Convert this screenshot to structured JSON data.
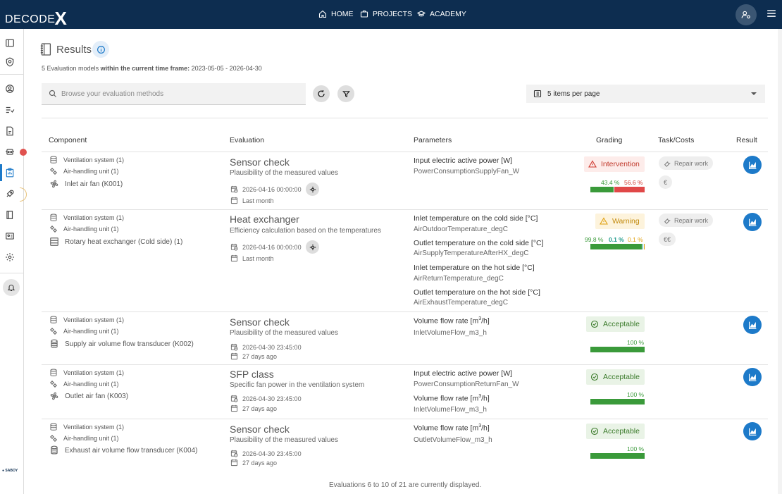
{
  "app": {
    "brand": "DECODE",
    "brand_x": "X",
    "nav": [
      {
        "label": "HOME",
        "icon": "home-icon"
      },
      {
        "label": "PROJECTS",
        "icon": "folder-icon"
      },
      {
        "label": "ACADEMY",
        "icon": "graduation-cap-icon"
      }
    ],
    "company_label": "SABOY",
    "accent_color": "#0d2d50",
    "primary_color": "#1d7ac9"
  },
  "results": {
    "title": "Results",
    "count": "5",
    "models_text": "Evaluation models",
    "timeframe_label": "within the current time frame:",
    "timeframe_value": "2023-05-05 - 2026-04-30",
    "search_placeholder": "Browse your evaluation methods",
    "per_page": "5 items per page"
  },
  "table": {
    "headers": {
      "component": "Component",
      "evaluation": "Evaluation",
      "parameters": "Parameters",
      "grading": "Grading",
      "task_costs": "Task/Costs",
      "result": "Result"
    },
    "rows": [
      {
        "system": "Ventilation system (1)",
        "unit": "Air-handling unit (1)",
        "component": "Inlet air fan (K001)",
        "component_icon": "fan-icon",
        "eval_title": "Sensor check",
        "eval_sub": "Plausibility of the measured values",
        "date": "2026-04-16 00:00:00",
        "relative": "Last month",
        "params": [
          {
            "name": "Input electric active power [W]",
            "var": "PowerConsumptionSupplyFan_W"
          }
        ],
        "grade": "Intervention",
        "grade_type": "red",
        "pcts": [
          "43.4 %",
          "56.6 %"
        ],
        "pct_values": [
          43.4,
          56.6
        ],
        "task": "Repair work",
        "cost": "€"
      },
      {
        "system": "Ventilation system (1)",
        "unit": "Air-handling unit (1)",
        "component": "Rotary heat exchanger (Cold side) (1)",
        "component_icon": "heat-exchanger-icon",
        "eval_title": "Heat exchanger",
        "eval_sub": "Efficiency calculation based on the temperatures",
        "date": "2026-04-16 00:00:00",
        "relative": "Last month",
        "params": [
          {
            "name": "Inlet temperature on the cold side [°C]",
            "var": "AirOutdoorTemperature_degC"
          },
          {
            "name": "Outlet temperature on the cold side [°C]",
            "var": "AirSupplyTemperatureAfterHX_degC"
          },
          {
            "name": "Inlet temperature on the hot side [°C]",
            "var": "AirReturnTemperature_degC"
          },
          {
            "name": "Outlet temperature on the hot side [°C]",
            "var": "AirExhaustTemperature_degC"
          }
        ],
        "grade": "Warning",
        "grade_type": "yellow",
        "pcts": [
          "99.8 %",
          "0.1 %",
          "0.1 %"
        ],
        "pct_values": [
          99.8,
          0.1,
          0.1
        ],
        "task": "Repair work",
        "cost": "€€"
      },
      {
        "system": "Ventilation system (1)",
        "unit": "Air-handling unit (1)",
        "component": "Supply air volume flow transducer (K002)",
        "component_icon": "flow-transducer-icon",
        "eval_title": "Sensor check",
        "eval_sub": "Plausibility of the measured values",
        "date": "2026-04-30 23:45:00",
        "relative": "27 days ago",
        "params": [
          {
            "name": "Volume flow rate",
            "unit_base": "[m",
            "unit_sup": "3",
            "unit_end": "/h]",
            "var": "InletVolumeFlow_m3_h"
          }
        ],
        "grade": "Acceptable",
        "grade_type": "green",
        "pcts": [
          "100 %"
        ],
        "pct_values": [
          100
        ],
        "task": "",
        "cost": ""
      },
      {
        "system": "Ventilation system (1)",
        "unit": "Air-handling unit (1)",
        "component": "Outlet air fan (K003)",
        "component_icon": "fan-icon",
        "eval_title": "SFP class",
        "eval_sub": "Specific fan power in the ventilation system",
        "date": "2026-04-30 23:45:00",
        "relative": "27 days ago",
        "params": [
          {
            "name": "Input electric active power [W]",
            "var": "PowerConsumptionReturnFan_W"
          },
          {
            "name": "Volume flow rate",
            "unit_base": "[m",
            "unit_sup": "3",
            "unit_end": "/h]",
            "var": "InletVolumeFlow_m3_h"
          }
        ],
        "grade": "Acceptable",
        "grade_type": "green",
        "pcts": [
          "100 %"
        ],
        "pct_values": [
          100
        ],
        "task": "",
        "cost": ""
      },
      {
        "system": "Ventilation system (1)",
        "unit": "Air-handling unit (1)",
        "component": "Exhaust air volume flow transducer (K004)",
        "component_icon": "flow-transducer-icon",
        "eval_title": "Sensor check",
        "eval_sub": "Plausibility of the measured values",
        "date": "2026-04-30 23:45:00",
        "relative": "27 days ago",
        "params": [
          {
            "name": "Volume flow rate",
            "unit_base": "[m",
            "unit_sup": "3",
            "unit_end": "/h]",
            "var": "OutletVolumeFlow_m3_h"
          }
        ],
        "grade": "Acceptable",
        "grade_type": "green",
        "pcts": [
          "100 %"
        ],
        "pct_values": [
          100
        ],
        "task": "",
        "cost": ""
      }
    ]
  },
  "footer": "Evaluations 6 to 10 of 21 are currently displayed."
}
